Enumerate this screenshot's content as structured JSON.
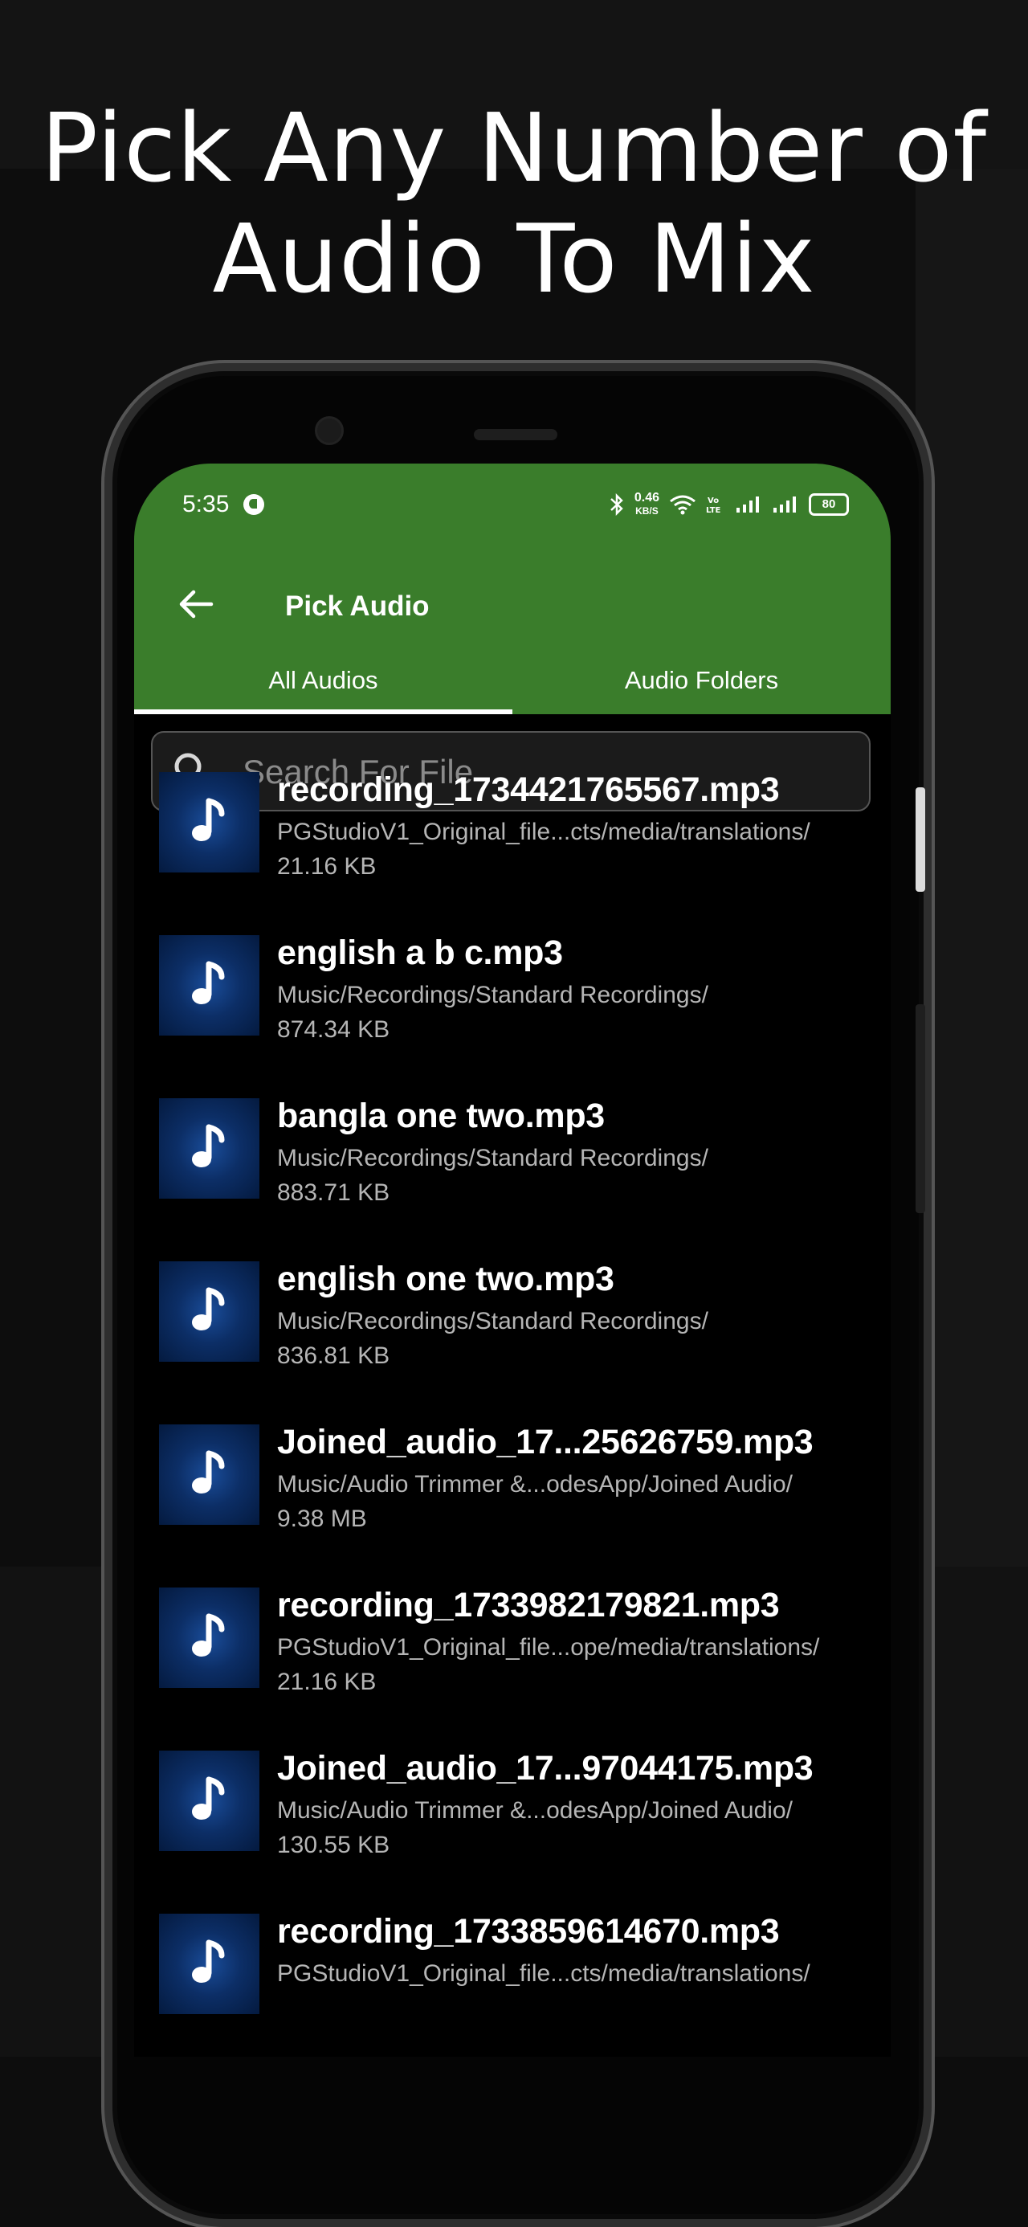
{
  "headline": {
    "line1": "Pick Any Number of",
    "line2": "Audio To Mix"
  },
  "status_bar": {
    "time": "5:35",
    "net_speed_value": "0.46",
    "net_speed_unit": "KB/S",
    "volte": "Vo\nLTE",
    "battery": "80"
  },
  "toolbar": {
    "title": "Pick Audio"
  },
  "tabs": [
    {
      "label": "All Audios",
      "active": true
    },
    {
      "label": "Audio Folders",
      "active": false
    }
  ],
  "search": {
    "placeholder": "Search For File"
  },
  "colors": {
    "appbar": "#3a7d2b",
    "background": "#000000"
  },
  "files": [
    {
      "name": "recording_1734421765567.mp3",
      "path": "PGStudioV1_Original_file...cts/media/translations/",
      "size": "21.16 KB"
    },
    {
      "name": "english a b c.mp3",
      "path": "Music/Recordings/Standard Recordings/",
      "size": "874.34 KB"
    },
    {
      "name": "bangla one two.mp3",
      "path": "Music/Recordings/Standard Recordings/",
      "size": "883.71 KB"
    },
    {
      "name": "english one two.mp3",
      "path": "Music/Recordings/Standard Recordings/",
      "size": "836.81 KB"
    },
    {
      "name": "Joined_audio_17...25626759.mp3",
      "path": "Music/Audio Trimmer &...odesApp/Joined Audio/",
      "size": "9.38 MB"
    },
    {
      "name": "recording_1733982179821.mp3",
      "path": "PGStudioV1_Original_file...ope/media/translations/",
      "size": "21.16 KB"
    },
    {
      "name": "Joined_audio_17...97044175.mp3",
      "path": "Music/Audio Trimmer &...odesApp/Joined Audio/",
      "size": "130.55 KB"
    },
    {
      "name": "recording_1733859614670.mp3",
      "path": "PGStudioV1_Original_file...cts/media/translations/",
      "size": ""
    }
  ]
}
